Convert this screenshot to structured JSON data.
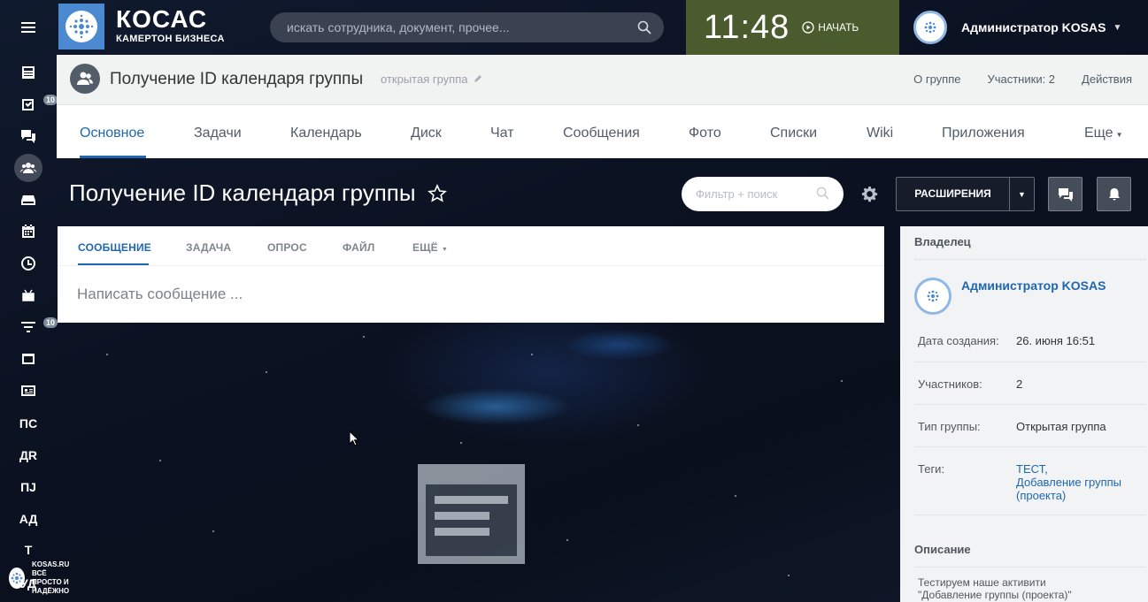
{
  "topbar": {
    "logo_big": "КОСАС",
    "logo_small": "КАМЕРТОН БИЗНЕСА",
    "search_placeholder": "искать сотрудника, документ, прочее...",
    "clock_time": "11:48",
    "clock_action": "НАЧАТЬ",
    "user_name": "Администратор KOSAS"
  },
  "sidebar": {
    "badges": {
      "tasks": "10",
      "filter": "10"
    },
    "text_items": [
      "ПС",
      "ДR",
      "ПJ",
      "АД",
      "Т",
      "УД"
    ],
    "footer_line1": "KOSAS.RU",
    "footer_line2": "ВСЁ ПРОСТО И НАДЁЖНО"
  },
  "group_header": {
    "title": "Получение ID календаря группы",
    "type": "открытая группа",
    "links": [
      "О группе",
      "Участники: 2",
      "Действия"
    ]
  },
  "tabs": [
    "Основное",
    "Задачи",
    "Календарь",
    "Диск",
    "Чат",
    "Сообщения",
    "Фото",
    "Списки",
    "Wiki",
    "Приложения",
    "Еще"
  ],
  "page": {
    "title": "Получение ID календаря группы",
    "filter_placeholder": "Фильтр + поиск",
    "extensions_label": "РАСШИРЕНИЯ"
  },
  "composer": {
    "tabs": [
      "СООБЩЕНИЕ",
      "ЗАДАЧА",
      "ОПРОС",
      "ФАЙЛ",
      "ЕЩЁ"
    ],
    "placeholder": "Написать сообщение ..."
  },
  "side_panel": {
    "owner_title": "Владелец",
    "owner_name": "Администратор KOSAS",
    "rows": [
      {
        "label": "Дата создания:",
        "value": "26. июня 16:51"
      },
      {
        "label": "Участников:",
        "value": "2"
      },
      {
        "label": "Тип группы:",
        "value": "Открытая группа"
      }
    ],
    "tags_label": "Теги:",
    "tags": [
      "ТЕСТ,",
      "Добавление группы",
      "(проекта)"
    ],
    "description_title": "Описание",
    "description_line1": "Тестируем наше активити",
    "description_line2": "\"Добавление группы (проекта)\""
  },
  "colors": {
    "accent": "#2067b0",
    "clock_bg": "#4a5c2d",
    "logo_bg": "#4b8ad1"
  }
}
